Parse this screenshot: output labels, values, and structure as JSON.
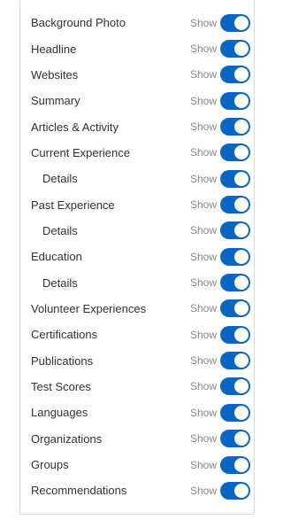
{
  "settings": {
    "show_label": "Show",
    "items": [
      {
        "label": "Background Photo",
        "indent": false,
        "on": true
      },
      {
        "label": "Headline",
        "indent": false,
        "on": true
      },
      {
        "label": "Websites",
        "indent": false,
        "on": true
      },
      {
        "label": "Summary",
        "indent": false,
        "on": true
      },
      {
        "label": "Articles & Activity",
        "indent": false,
        "on": true
      },
      {
        "label": "Current Experience",
        "indent": false,
        "on": true
      },
      {
        "label": "Details",
        "indent": true,
        "on": true
      },
      {
        "label": "Past Experience",
        "indent": false,
        "on": true
      },
      {
        "label": "Details",
        "indent": true,
        "on": true
      },
      {
        "label": "Education",
        "indent": false,
        "on": true
      },
      {
        "label": "Details",
        "indent": true,
        "on": true
      },
      {
        "label": "Volunteer Experiences",
        "indent": false,
        "on": true
      },
      {
        "label": "Certifications",
        "indent": false,
        "on": true
      },
      {
        "label": "Publications",
        "indent": false,
        "on": true
      },
      {
        "label": "Test Scores",
        "indent": false,
        "on": true
      },
      {
        "label": "Languages",
        "indent": false,
        "on": true
      },
      {
        "label": "Organizations",
        "indent": false,
        "on": true
      },
      {
        "label": "Groups",
        "indent": false,
        "on": true
      },
      {
        "label": "Recommendations",
        "indent": false,
        "on": true
      }
    ]
  },
  "colors": {
    "toggle_on": "#0a66c2",
    "label_text": "#333333",
    "show_text": "#8a8a8a"
  }
}
